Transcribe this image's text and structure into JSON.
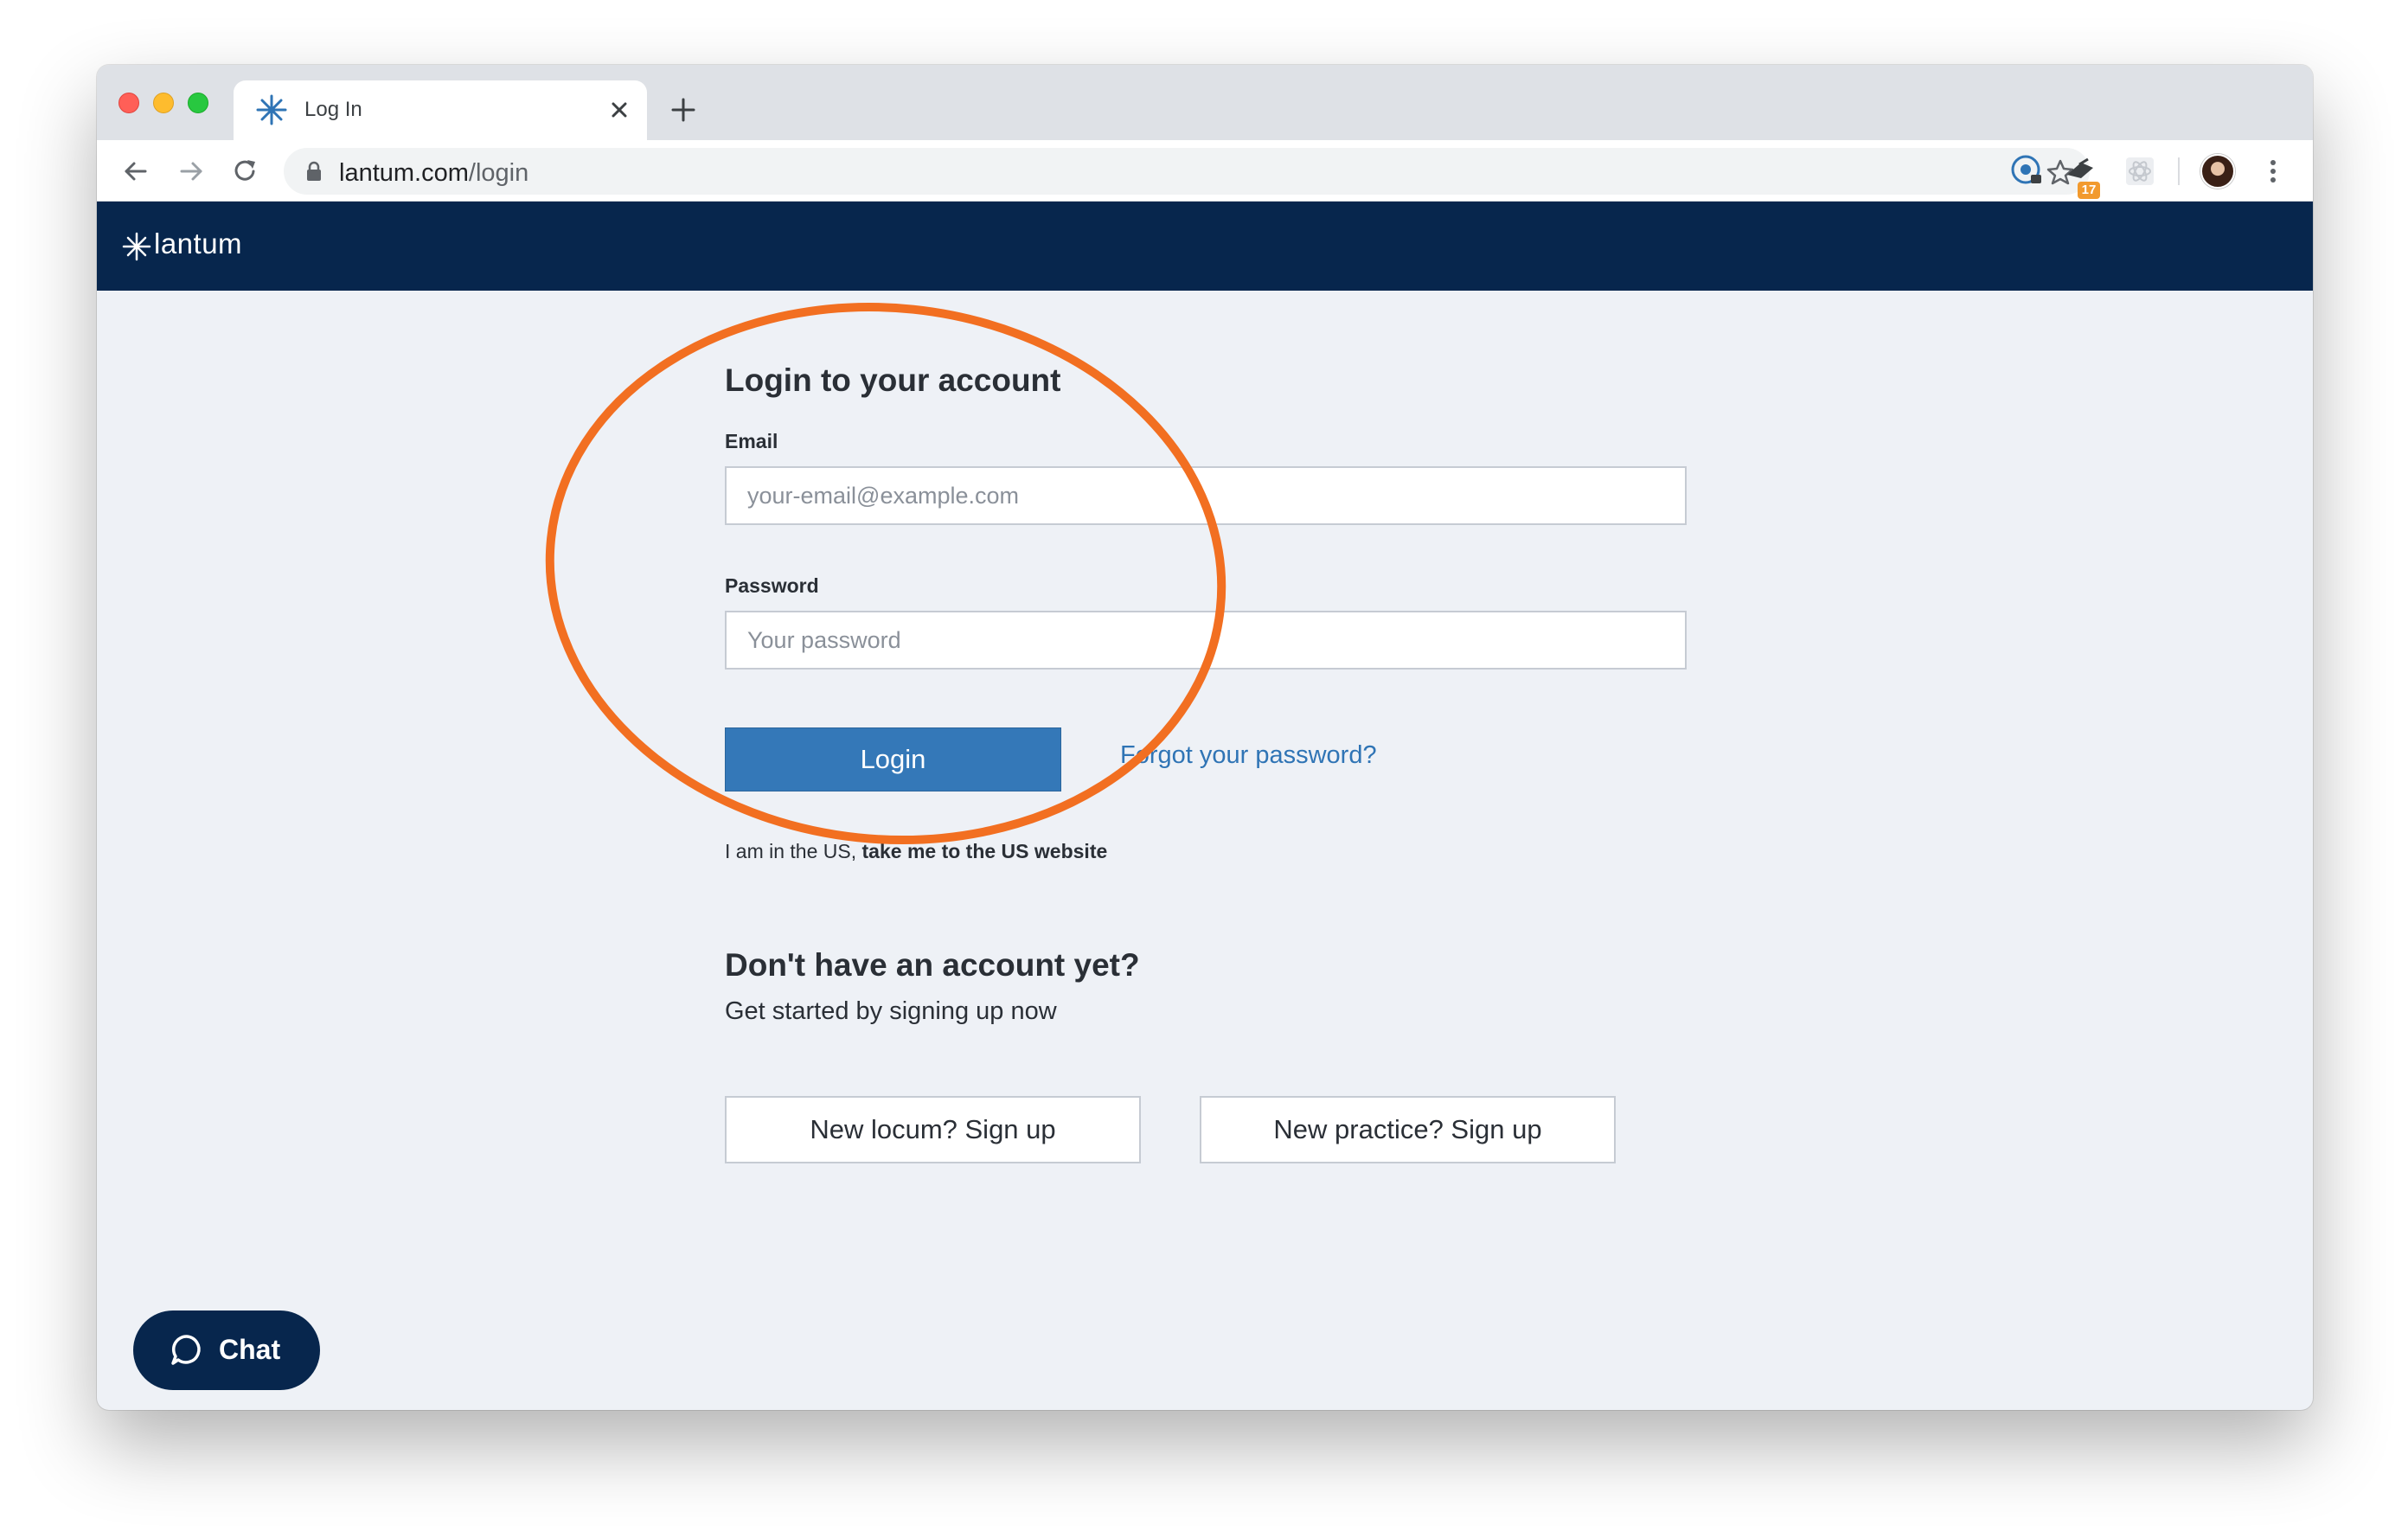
{
  "browser": {
    "tab_title": "Log In",
    "url_domain": "lantum.com",
    "url_path": "/login",
    "extension_badge": "17",
    "icons": [
      "back-icon",
      "forward-icon",
      "reload-icon",
      "lock-icon",
      "star-icon",
      "extension-icon",
      "kebab-menu-icon"
    ]
  },
  "site": {
    "logo_text": "lantum",
    "brand_color": "#07264d",
    "accent_color": "#3478b8"
  },
  "login": {
    "heading": "Login to your account",
    "email_label": "Email",
    "email_placeholder": "your-email@example.com",
    "password_label": "Password",
    "password_placeholder": "Your password",
    "login_button": "Login",
    "forgot_link": "Forgot your password?",
    "us_text": "I am in the US, ",
    "us_link": "take me to the US website"
  },
  "signup": {
    "heading": "Don't have an account yet?",
    "subtext": "Get started by signing up now",
    "locum_button": "New locum? Sign up",
    "practice_button": "New practice? Sign up"
  },
  "chat": {
    "label": "Chat"
  },
  "annotation": {
    "shape": "ellipse",
    "color": "#f26f21"
  }
}
